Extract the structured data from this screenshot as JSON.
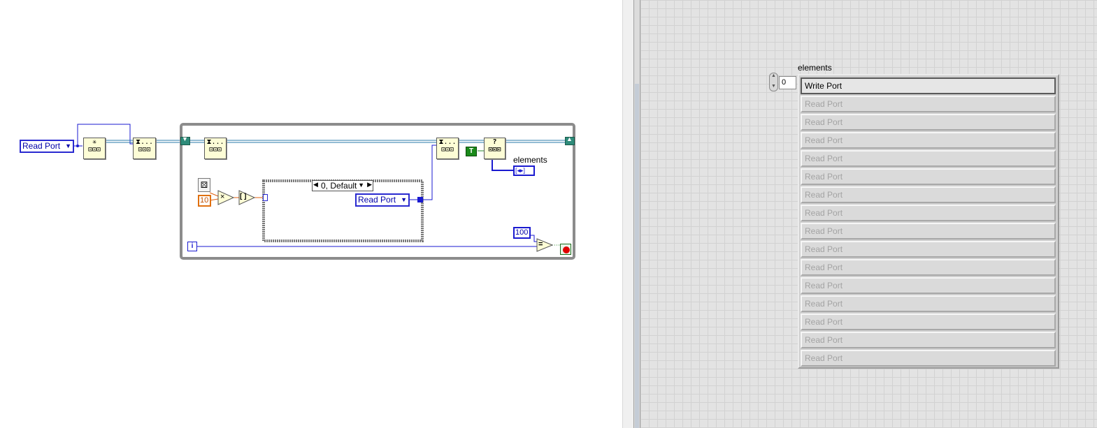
{
  "block_diagram": {
    "enum_constant_outer": "Read Port",
    "enum_constant_case": "Read Port",
    "case_selector": "0, Default",
    "numeric_constant_10": "10",
    "numeric_constant_100": "100",
    "iteration_terminal": "i",
    "true_constant": "T",
    "indicator_label": "elements",
    "queue_function_glyph": "⧗...",
    "preview_glyph": "?",
    "multiply_glyph": "×",
    "equal_glyph": "=",
    "round_glyph": "[ ]"
  },
  "front_panel": {
    "array_label": "elements",
    "array_index": "0",
    "elements": [
      "Write Port",
      "Read Port",
      "Read Port",
      "Read Port",
      "Read Port",
      "Read Port",
      "Read Port",
      "Read Port",
      "Read Port",
      "Read Port",
      "Read Port",
      "Read Port",
      "Read Port",
      "Read Port",
      "Read Port",
      "Read Port"
    ]
  }
}
